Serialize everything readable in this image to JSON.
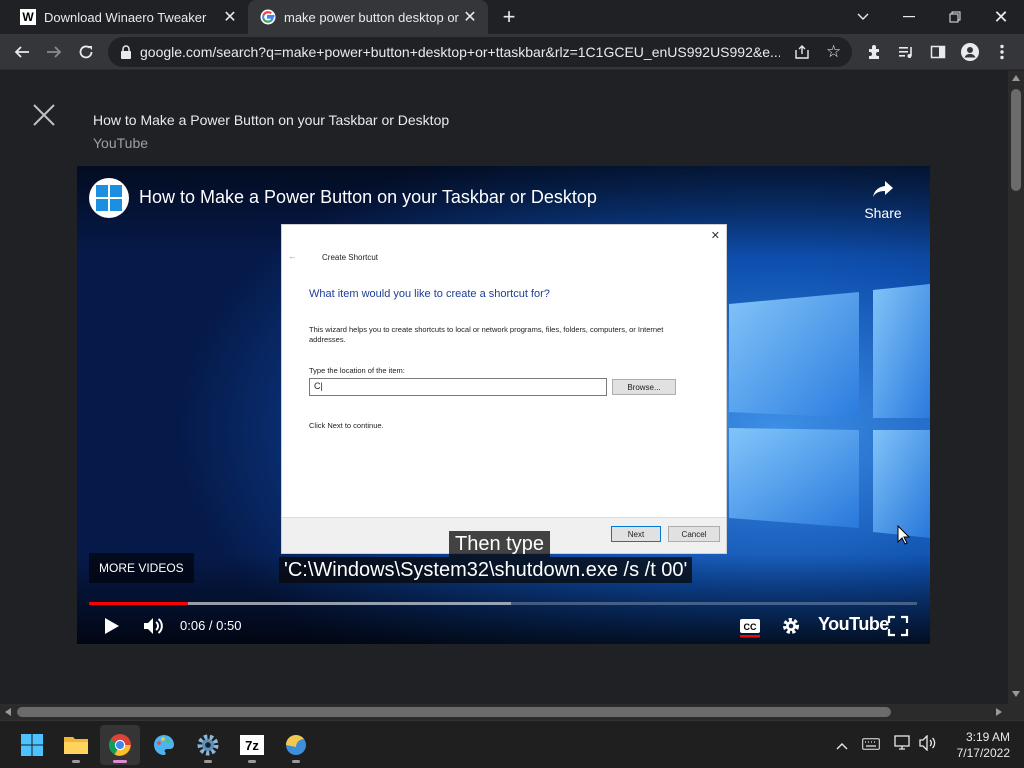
{
  "browser": {
    "tabs": [
      {
        "title": "Download Winaero Tweaker",
        "favicon": "W",
        "active": false
      },
      {
        "title": "make power button desktop or t",
        "favicon": "google-g",
        "active": true
      }
    ],
    "url": "google.com/search?q=make+power+button+desktop+or+ttaskbar&rlz=1C1GCEU_enUS992US992&e..."
  },
  "result": {
    "title": "How to Make a Power Button on your Taskbar or Desktop",
    "source": "YouTube"
  },
  "video": {
    "title": "How to Make a Power Button on your Taskbar or Desktop",
    "share_label": "Share",
    "more_videos_label": "MORE VIDEOS",
    "time": "0:06 / 0:50",
    "progress": 0.12,
    "buffered": 0.51,
    "brand": "YouTube",
    "caption_line1": "Then type",
    "caption_line2": "'C:\\Windows\\System32\\shutdown.exe /s /t 00'",
    "accent_color": "#ff0000"
  },
  "dialog": {
    "title": "Create Shortcut",
    "heading": "What item would you like to create a shortcut for?",
    "description": "This wizard helps you to create shortcuts to local or network programs, files, folders, computers, or Internet addresses.",
    "field_label": "Type the location of the item:",
    "field_value": "C|",
    "browse_label": "Browse...",
    "hint": "Click Next to continue.",
    "next_label": "Next",
    "cancel_label": "Cancel"
  },
  "taskbar": {
    "time": "3:19 AM",
    "date": "7/17/2022"
  }
}
